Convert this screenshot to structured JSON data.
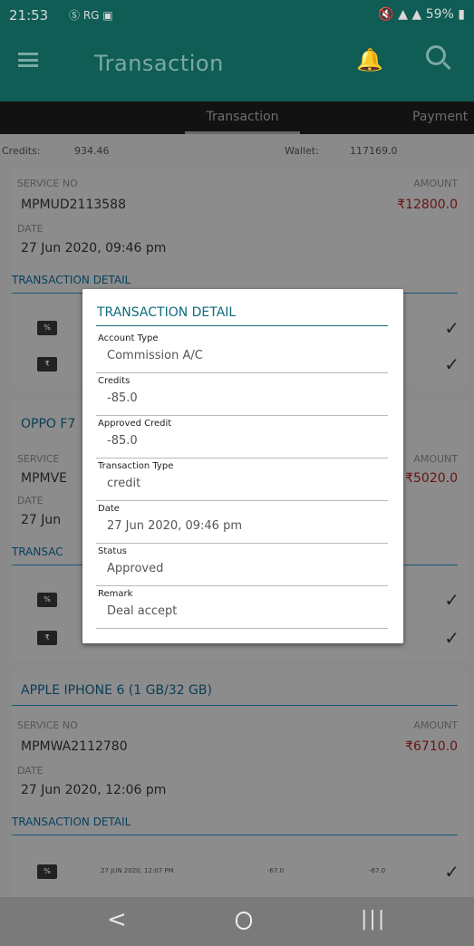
{
  "status": {
    "time": "21:53",
    "icons": "Ⓢ RG ▣",
    "right": "🔇 ▲ ▲ 59% ▮"
  },
  "appbar": {
    "title": "Transaction"
  },
  "tabs": {
    "active": "Transaction",
    "inactive": "Payment"
  },
  "summary": {
    "credits_label": "Credits:",
    "credits_value": "934.46",
    "wallet_label": "Wallet:",
    "wallet_value": "117169.0"
  },
  "card1": {
    "service_label": "SERVICE NO",
    "service_no": "MPMUD2113588",
    "amount_label": "AMOUNT",
    "amount": "₹12800.0",
    "date_label": "DATE",
    "date": "27 Jun 2020, 09:46 pm",
    "section": "TRANSACTION DETAIL"
  },
  "card2": {
    "title": "OPPO F7",
    "service_label": "SERVICE",
    "service_no": "MPMVE",
    "amount_label": "AMOUNT",
    "amount": "₹5020.0",
    "date_label": "DATE",
    "date": "27 Jun",
    "section": "TRANSAC"
  },
  "card3": {
    "title": "APPLE IPHONE 6 (1 GB/32 GB)",
    "service_label": "SERVICE NO",
    "service_no": "MPMWA2112780",
    "amount_label": "AMOUNT",
    "amount": "₹6710.0",
    "date_label": "DATE",
    "date": "27 Jun 2020, 12:06 pm",
    "section": "TRANSACTION DETAIL",
    "row": {
      "date": "27 JUN 2020, 12:07 PM",
      "credits": "-67.0",
      "approved": "-67.0"
    }
  },
  "modal": {
    "title": "TRANSACTION DETAIL",
    "fields": [
      {
        "label": "Account Type",
        "value": "Commission A/C"
      },
      {
        "label": "Credits",
        "value": "-85.0"
      },
      {
        "label": "Approved Credit",
        "value": "-85.0"
      },
      {
        "label": "Transaction Type",
        "value": "credit"
      },
      {
        "label": "Date",
        "value": "27 Jun 2020, 09:46 pm"
      },
      {
        "label": "Status",
        "value": "Approved"
      },
      {
        "label": "Remark",
        "value": "Deal accept"
      }
    ]
  },
  "icons": {
    "percent": "%",
    "rupee": "₹",
    "check": "✓",
    "back": "<",
    "recent": "|||"
  }
}
